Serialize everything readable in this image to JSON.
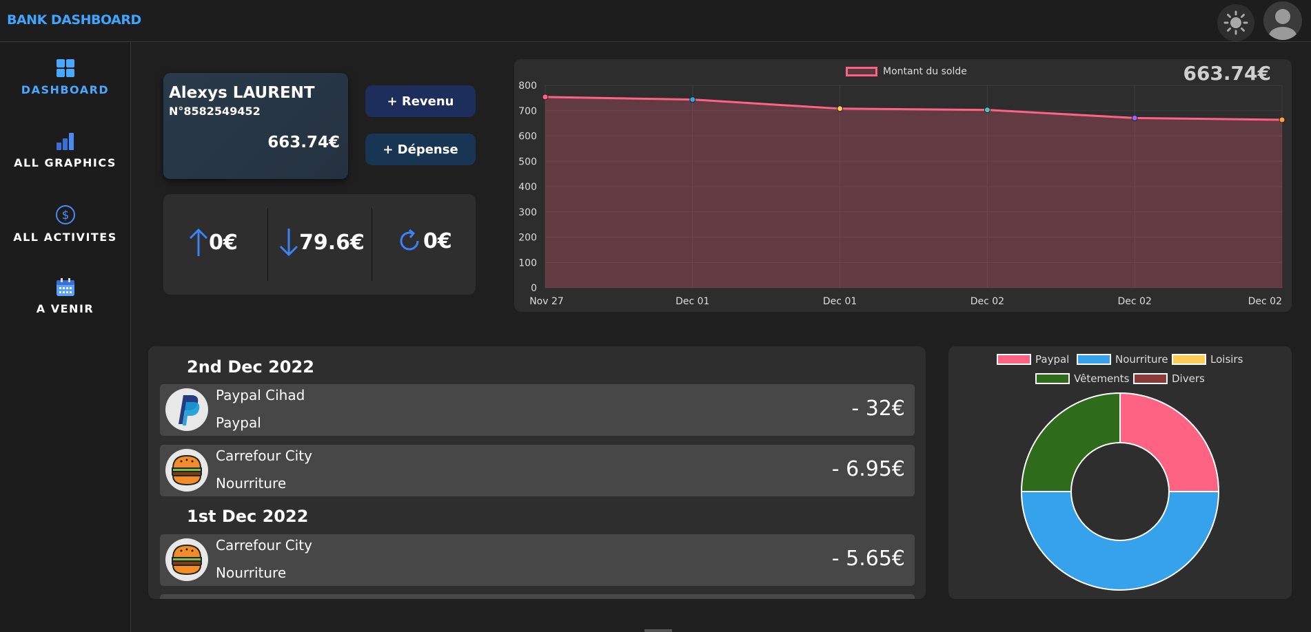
{
  "header": {
    "brand": "BANK DASHBOARD"
  },
  "sidebar": {
    "items": [
      {
        "label": "DASHBOARD",
        "icon": "dashboard-icon",
        "active": true
      },
      {
        "label": "ALL GRAPHICS",
        "icon": "bar-chart-icon",
        "active": false
      },
      {
        "label": "ALL ACTIVITES",
        "icon": "dollar-circle-icon",
        "active": false
      },
      {
        "label": "A VENIR",
        "icon": "calendar-icon",
        "active": false
      }
    ]
  },
  "account": {
    "name": "Alexys LAURENT",
    "number": "N°8582549452",
    "balance": "663.74€"
  },
  "actions": {
    "income": "+ Revenu",
    "expense": "+ Dépense"
  },
  "stats": {
    "income": "0€",
    "expense": "79.6€",
    "recurring": "0€"
  },
  "balance_chart": {
    "total": "663.74€"
  },
  "chart_data": [
    {
      "type": "area",
      "series": [
        {
          "name": "Montant du solde",
          "values": [
            754,
            744,
            708,
            703,
            671,
            664
          ],
          "color": "#ff6384"
        }
      ],
      "x": [
        "Nov 27",
        "Dec 01",
        "Dec 01",
        "Dec 02",
        "Dec 02",
        "Dec 02"
      ],
      "yticks": [
        "0",
        "100",
        "200",
        "300",
        "400",
        "500",
        "600",
        "700",
        "800"
      ],
      "ylim": [
        0,
        800
      ],
      "grid": true,
      "legend": "top-center",
      "point_colors": [
        "#ff6384",
        "#36a2eb",
        "#ffcd56",
        "#4bc0c0",
        "#9966ff",
        "#ff9f40"
      ]
    },
    {
      "type": "pie",
      "categories": [
        "Paypal",
        "Nourriture",
        "Loisirs",
        "Vêtements",
        "Divers"
      ],
      "values": [
        25,
        50,
        0,
        25,
        0
      ],
      "colors": [
        "#ff6384",
        "#36a2eb",
        "#ffcd56",
        "#2e6b1a",
        "#8b3a3a"
      ],
      "legend": "top"
    }
  ],
  "transactions": {
    "groups": [
      {
        "date": "2nd Dec 2022",
        "items": [
          {
            "name": "Paypal Cihad",
            "category": "Paypal",
            "amount": "- 32€",
            "icon": "paypal-icon"
          },
          {
            "name": "Carrefour City",
            "category": "Nourriture",
            "amount": "- 6.95€",
            "icon": "burger-icon"
          }
        ]
      },
      {
        "date": "1st Dec 2022",
        "items": [
          {
            "name": "Carrefour City",
            "category": "Nourriture",
            "amount": "- 5.65€",
            "icon": "burger-icon"
          }
        ]
      }
    ]
  },
  "colors": {
    "accent": "#3ea6ff",
    "arrow": "#3b82f6",
    "line": "#ff6384"
  }
}
